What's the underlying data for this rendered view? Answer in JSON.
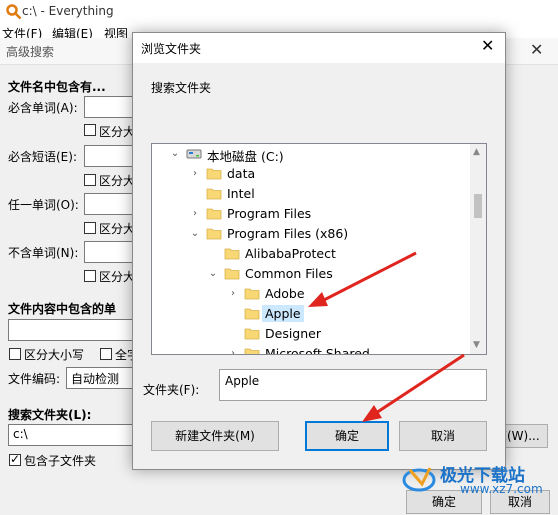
{
  "app": {
    "title": "c:\\ - Everything",
    "menu": [
      "文件(F)",
      "编辑(E)",
      "视图"
    ]
  },
  "advanced": {
    "title": "高级搜索",
    "name_section": "文件名中包含有...",
    "fields": [
      {
        "label": "必含单词(A):",
        "checkbox": "区分大"
      },
      {
        "label": "必含短语(E):",
        "checkbox": "区分大"
      },
      {
        "label": "任一单词(O):",
        "checkbox": "区分大"
      },
      {
        "label": "不含单词(N):",
        "checkbox": "区分大"
      }
    ],
    "content_section": "文件内容中包含的单",
    "match_case": "区分大小写",
    "whole_word": "全字",
    "encoding_label": "文件编码:",
    "encoding_value": "自动检测",
    "search_folder_label": "搜索文件夹(L):",
    "search_folder_value": "c:\\",
    "browse_button": "览(W)...",
    "include_subfolders": "包含子文件夹",
    "ok": "确定",
    "cancel": "取消"
  },
  "dialog": {
    "title": "浏览文件夹",
    "prompt": "搜索文件夹",
    "tree": [
      {
        "label": "本地磁盘 (C:)",
        "level": 0,
        "expanded": true,
        "type": "drive"
      },
      {
        "label": "data",
        "level": 1,
        "expanded": false
      },
      {
        "label": "Intel",
        "level": 1,
        "leaf": true
      },
      {
        "label": "Program Files",
        "level": 1,
        "expanded": false
      },
      {
        "label": "Program Files (x86)",
        "level": 1,
        "expanded": true
      },
      {
        "label": "AlibabaProtect",
        "level": 2,
        "leaf": true
      },
      {
        "label": "Common Files",
        "level": 2,
        "expanded": true
      },
      {
        "label": "Adobe",
        "level": 3,
        "expanded": false
      },
      {
        "label": "Apple",
        "level": 3,
        "leaf": true,
        "selected": true
      },
      {
        "label": "Designer",
        "level": 3,
        "leaf": true
      },
      {
        "label": "Microsoft Shared",
        "level": 3,
        "expanded": false
      }
    ],
    "folder_label": "文件夹(F):",
    "folder_value": "Apple",
    "new_folder_button": "新建文件夹(M)",
    "ok_button": "确定",
    "cancel_button": "取消"
  },
  "watermark": {
    "brand": "极光下载站",
    "url": "www.xz7.com"
  },
  "colors": {
    "annotation_arrow": "#e0241e",
    "selection": "#cce8ff",
    "folder": "#f8d775",
    "accent_button_border": "#0078d7"
  }
}
